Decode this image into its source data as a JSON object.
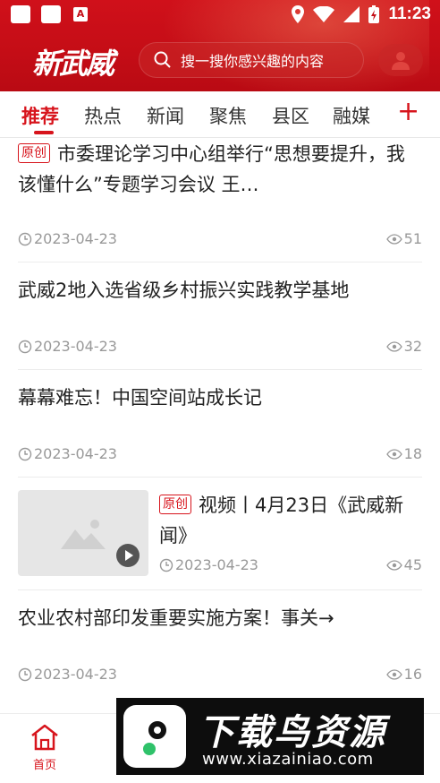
{
  "status_bar": {
    "time": "11:23"
  },
  "header": {
    "logo": "新武威",
    "search_placeholder": "搜一搜你感兴趣的内容"
  },
  "tabs": [
    {
      "label": "推荐",
      "active": true
    },
    {
      "label": "热点"
    },
    {
      "label": "新闻"
    },
    {
      "label": "聚焦"
    },
    {
      "label": "县区"
    },
    {
      "label": "融媒"
    }
  ],
  "feed": [
    {
      "badge": "原创",
      "title": "市委理论学习中心组举行“思想要提升，我该懂什么”专题学习会议 王…",
      "date": "2023-04-23",
      "views": "51"
    },
    {
      "badge": "",
      "title": "武威2地入选省级乡村振兴实践教学基地",
      "date": "2023-04-23",
      "views": "32"
    },
    {
      "badge": "",
      "title": "幕幕难忘！中国空间站成长记",
      "date": "2023-04-23",
      "views": "18"
    },
    {
      "badge": "原创",
      "title": "视频丨4月23日《武威新闻》",
      "date": "2023-04-23",
      "views": "45",
      "thumbnail": "video-placeholder"
    },
    {
      "badge": "",
      "title": "农业农村部印发重要实施方案！事关→",
      "date": "2023-04-23",
      "views": "16"
    }
  ],
  "bottom_nav": {
    "home_label": "首页"
  },
  "watermark": {
    "title": "下载鸟资源",
    "url": "www.xiazainiao.com"
  },
  "colors": {
    "brand_red": "#d7141c",
    "header_red": "#c40d16",
    "meta_gray": "#999999"
  }
}
